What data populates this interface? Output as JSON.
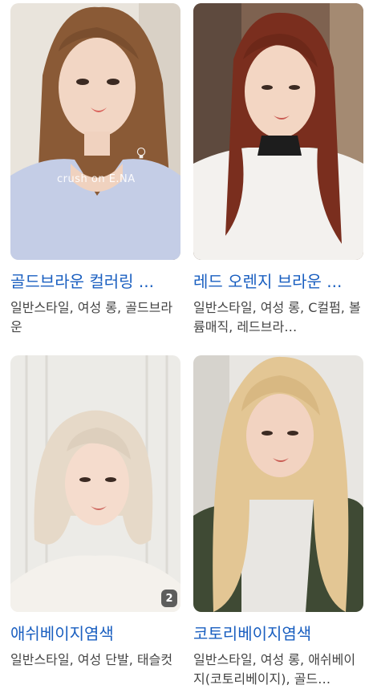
{
  "cards": [
    {
      "title": "골드브라운 컬러링 ...",
      "tags": "일반스타일, 여성 롱, 골드브라운",
      "watermark": "crush on E.NA"
    },
    {
      "title": "레드 오렌지 브라운 ...",
      "tags": "일반스타일, 여성 롱, C컬펌, 볼륨매직, 레드브라…"
    },
    {
      "title": "애쉬베이지염색",
      "tags": "일반스타일, 여성 단발, 태슬컷",
      "image_count": "2"
    },
    {
      "title": "코토리베이지염색",
      "tags": "일반스타일, 여성 롱, 애쉬베이지(코토리베이지), 골드…"
    }
  ],
  "icons": {
    "watermark": "lightbulb-icon"
  },
  "colors": {
    "title": "#1a5fc0",
    "tags": "#444444",
    "badge_bg": "#3c3c3c"
  }
}
